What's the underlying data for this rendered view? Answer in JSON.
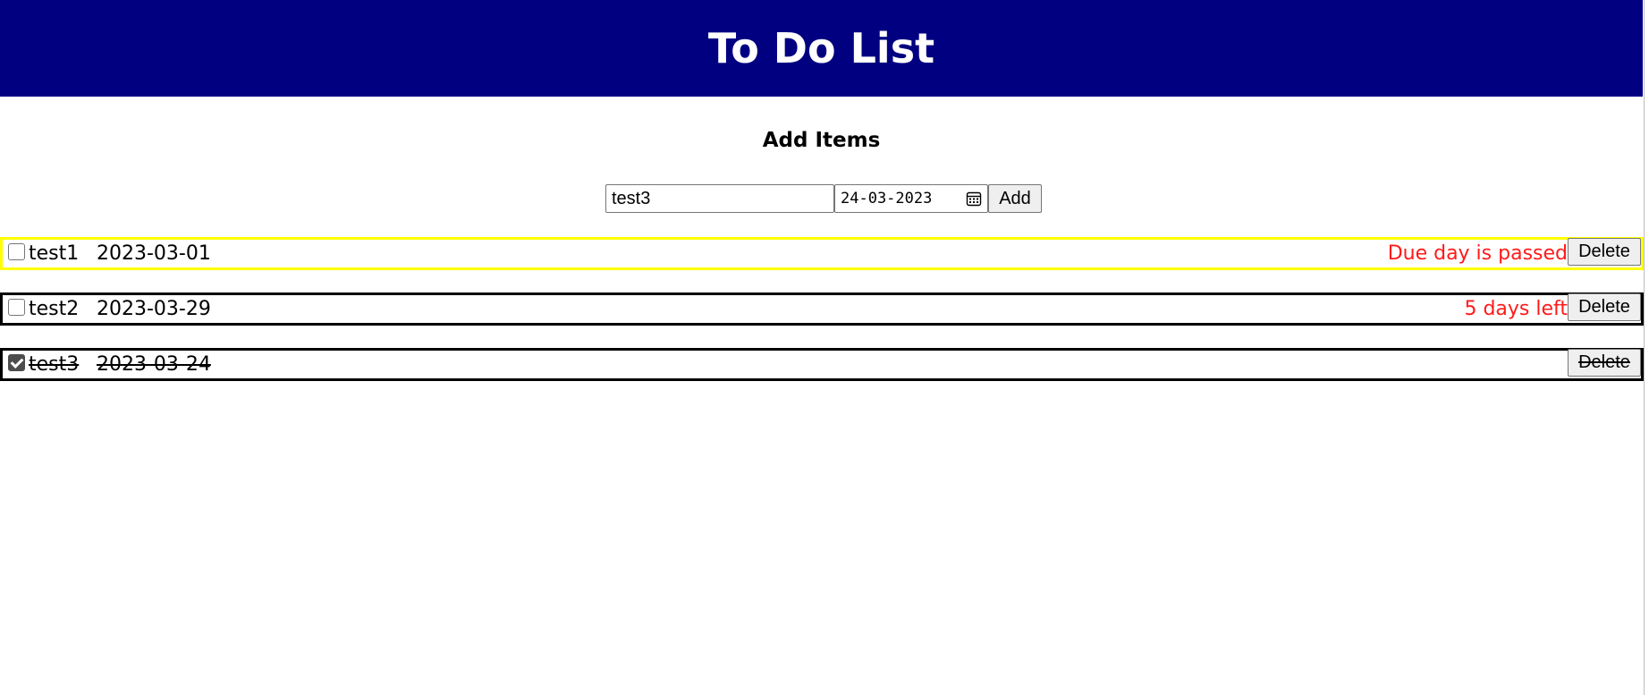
{
  "header": {
    "title": "To Do List",
    "bg_color": "#000080"
  },
  "add_section": {
    "heading": "Add Items",
    "item_value": "test3",
    "date_value": "24-03-2023",
    "add_label": "Add"
  },
  "todos": [
    {
      "name": "test1",
      "date": "2023-03-01",
      "checked": false,
      "status": "Due day is passed",
      "border_color": "#ffff00",
      "delete_label": "Delete"
    },
    {
      "name": "test2",
      "date": "2023-03-29",
      "checked": false,
      "status": "5 days left",
      "border_color": "#000000",
      "delete_label": "Delete"
    },
    {
      "name": "test3",
      "date": "2023-03-24",
      "checked": true,
      "status": "",
      "border_color": "#000000",
      "delete_label": "Delete"
    }
  ],
  "colors": {
    "status_text": "#ff1a1a",
    "overdue_border": "#ffff00"
  }
}
